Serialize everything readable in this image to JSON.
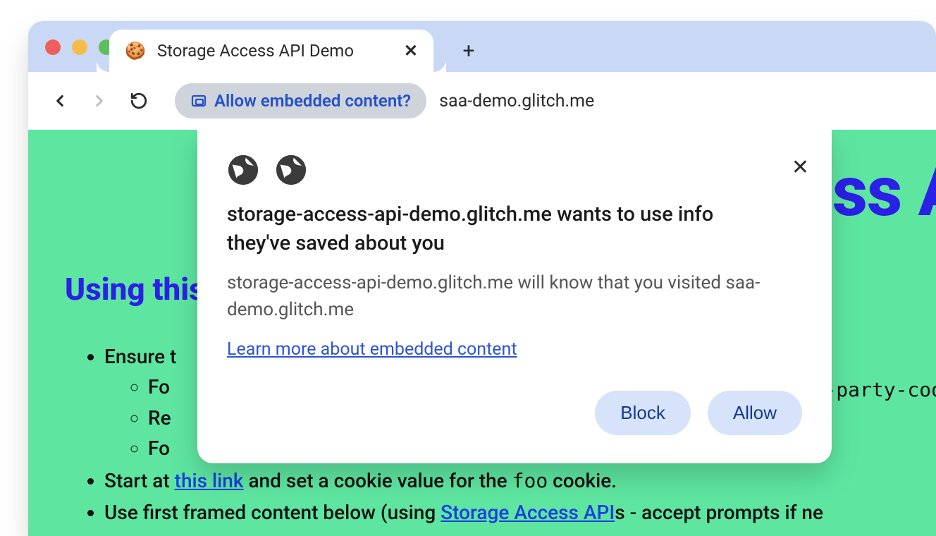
{
  "window": {
    "tab_title": "Storage Access API Demo",
    "favicon": "🍪"
  },
  "toolbar": {
    "chip_label": "Allow embedded content?",
    "url": "saa-demo.glitch.me"
  },
  "page": {
    "partial_heading": "ss A",
    "section_heading": "Using this",
    "list": {
      "item1_prefix": "Ensure t",
      "sub1": "Fo",
      "sub2": "Re",
      "sub3": "Fo",
      "item2_a": "Start at ",
      "item2_link": "this link",
      "item2_b": " and set a cookie value for the ",
      "item2_mono": "foo",
      "item2_c": " cookie.",
      "item3_a": "Use first framed content below (using ",
      "item3_link": "Storage Access API",
      "item3_b": "s - accept prompts if ne",
      "side_mono": "-party-coo"
    }
  },
  "popup": {
    "title": "storage-access-api-demo.glitch.me wants to use info they've saved about you",
    "body": "storage-access-api-demo.glitch.me will know that you visited saa-demo.glitch.me",
    "learn_more": "Learn more about embedded content",
    "block": "Block",
    "allow": "Allow"
  }
}
